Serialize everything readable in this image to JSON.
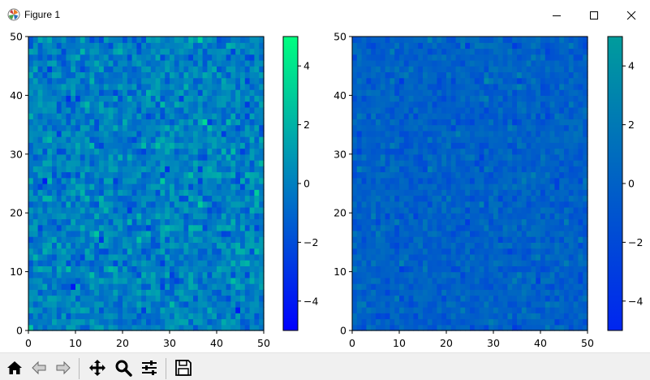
{
  "window": {
    "title": "Figure 1",
    "app_icon": "matplotlib-icon",
    "controls": [
      "minimize-icon",
      "maximize-icon",
      "close-icon"
    ]
  },
  "toolbar": {
    "buttons": [
      {
        "name": "home-button",
        "icon": "home-icon"
      },
      {
        "name": "back-button",
        "icon": "arrow-left-icon"
      },
      {
        "name": "forward-button",
        "icon": "arrow-right-icon"
      },
      {
        "name": "pan-button",
        "icon": "move-icon"
      },
      {
        "name": "zoom-button",
        "icon": "magnifier-icon"
      },
      {
        "name": "configure-subplots-button",
        "icon": "sliders-icon"
      },
      {
        "name": "save-button",
        "icon": "floppy-disk-icon"
      }
    ]
  },
  "chart_data": [
    {
      "type": "heatmap",
      "grid": [
        50,
        50
      ],
      "xlim": [
        0,
        50
      ],
      "ylim": [
        0,
        50
      ],
      "xticks": [
        "0",
        "10",
        "20",
        "30",
        "40",
        "50"
      ],
      "yticks": [
        "0",
        "10",
        "20",
        "30",
        "40",
        "50"
      ],
      "colormap": "winter",
      "colors": {
        "low": "#0000ff",
        "high": "#00ff80"
      },
      "colorbar": {
        "range": [
          -5,
          5
        ],
        "ticks": [
          "4",
          "2",
          "0",
          "−2",
          "−4"
        ],
        "tick_values": [
          4,
          2,
          0,
          -2,
          -4
        ]
      },
      "value_distribution": {
        "mean": 0,
        "std": 1
      }
    },
    {
      "type": "heatmap",
      "grid": [
        50,
        50
      ],
      "xlim": [
        0,
        50
      ],
      "ylim": [
        0,
        50
      ],
      "xticks": [
        "0",
        "10",
        "20",
        "30",
        "40",
        "50"
      ],
      "yticks": [
        "0",
        "10",
        "20",
        "30",
        "40",
        "50"
      ],
      "colormap": "winter (truncated)",
      "colors": {
        "low": "#0025f0",
        "high": "#009c9c"
      },
      "colorbar": {
        "range": [
          -5,
          5
        ],
        "ticks": [
          "4",
          "2",
          "0",
          "−2",
          "−4"
        ],
        "tick_values": [
          4,
          2,
          0,
          -2,
          -4
        ]
      },
      "value_distribution": {
        "mean": 0,
        "std": 1
      }
    }
  ]
}
